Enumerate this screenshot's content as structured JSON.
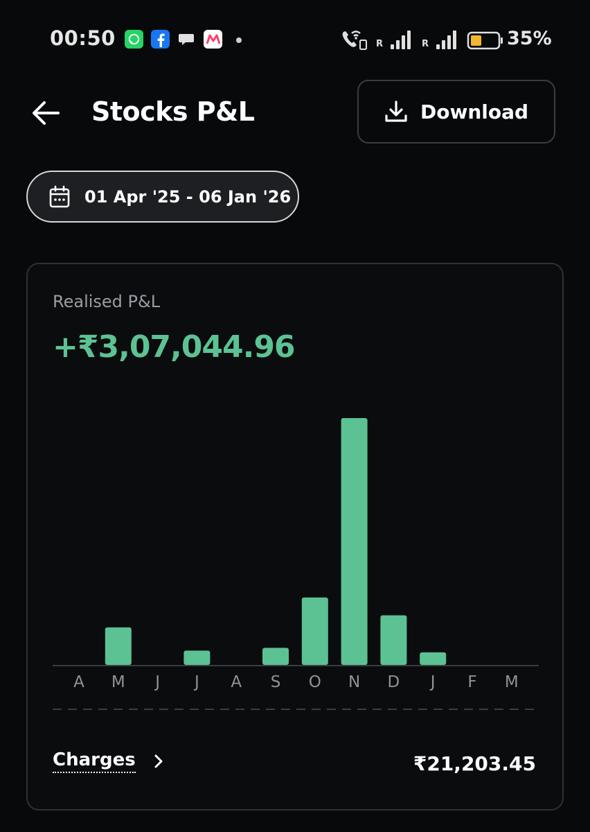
{
  "status_bar": {
    "time": "00:50",
    "apps": [
      "whatsapp-icon",
      "facebook-icon",
      "chat-icon",
      "myntra-icon"
    ],
    "signal_1_label": "R",
    "signal_2_label": "R",
    "battery_percent": "35%"
  },
  "header": {
    "title": "Stocks P&L",
    "download_label": "Download"
  },
  "date_range": {
    "label": "01 Apr '25 - 06 Jan '26"
  },
  "card": {
    "label": "Realised P&L",
    "value": "+₹3,07,044.96",
    "charges_label": "Charges",
    "charges_value": "₹21,203.45"
  },
  "colors": {
    "accent_green": "#5cc294",
    "background": "#08090b"
  },
  "chart_data": {
    "type": "bar",
    "categories": [
      "A",
      "M",
      "J",
      "J",
      "A",
      "S",
      "O",
      "N",
      "D",
      "J",
      "F",
      "M"
    ],
    "values": [
      0,
      15.2,
      0,
      5.8,
      0,
      6.9,
      27.3,
      100,
      20.1,
      5.1,
      0,
      0
    ],
    "ylim": [
      0,
      100
    ],
    "grid": false
  }
}
